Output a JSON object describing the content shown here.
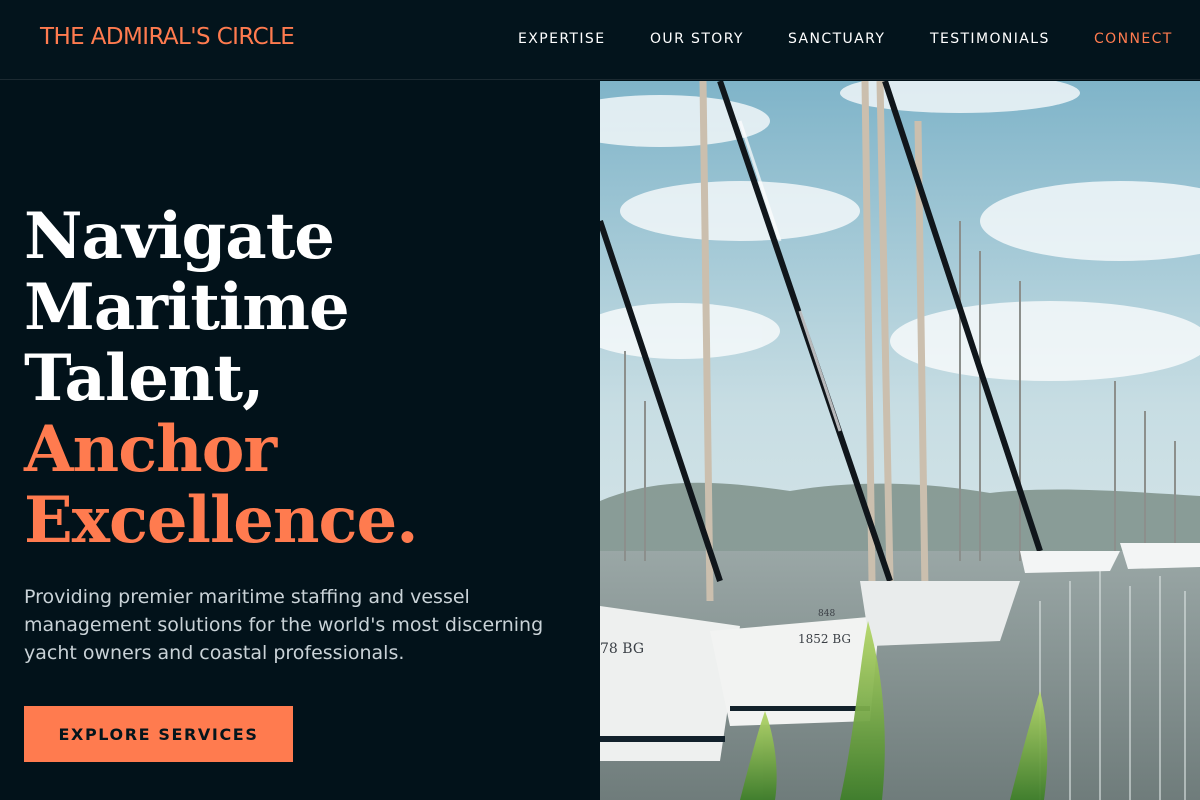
{
  "brand": {
    "name": "THE ADMIRAL'S CIRCLE"
  },
  "nav": {
    "items": [
      {
        "label": "EXPERTISE"
      },
      {
        "label": "OUR STORY"
      },
      {
        "label": "SANCTUARY"
      },
      {
        "label": "TESTIMONIALS"
      },
      {
        "label": "CONNECT"
      }
    ]
  },
  "hero": {
    "headline_lines": [
      "Navigate",
      "Maritime",
      "Talent,"
    ],
    "accent_lines": [
      "Anchor",
      "Excellence."
    ],
    "subtext": "Providing premier maritime staffing and vessel management solutions for the world's most discerning yacht owners and coastal professionals.",
    "cta_label": "EXPLORE SERVICES"
  },
  "image": {
    "hull_markings": [
      "78 BG",
      "1852 BG",
      "848"
    ]
  },
  "colors": {
    "accent": "#ff7b4f",
    "background": "#02121a",
    "text": "#ffffff",
    "muted_text": "#c9d2d7"
  }
}
